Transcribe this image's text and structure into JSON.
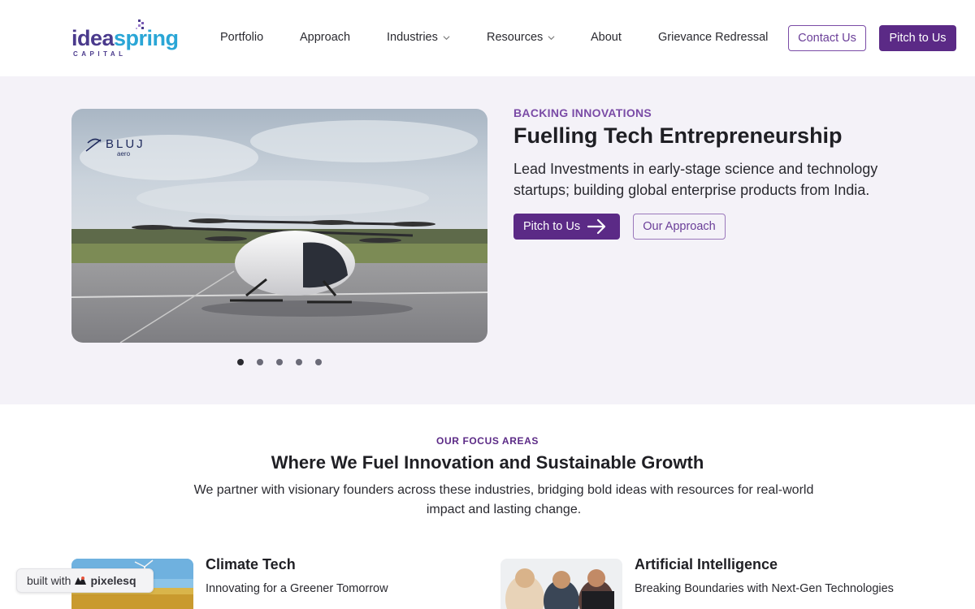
{
  "header": {
    "logo": {
      "part1": "idea",
      "part2": "spring",
      "sub": "CAPITAL"
    },
    "nav": [
      {
        "label": "Portfolio"
      },
      {
        "label": "Approach"
      },
      {
        "label": "Industries"
      },
      {
        "label": "Resources"
      },
      {
        "label": "About"
      },
      {
        "label": "Grievance Redressal"
      }
    ],
    "contact_label": "Contact Us",
    "pitch_label": "Pitch to Us"
  },
  "hero": {
    "image_logo": "BLUJ aero",
    "image_logo_main": "BLUJ",
    "image_logo_sub": "aero",
    "eyebrow": "BACKING INNOVATIONS",
    "title": "Fuelling Tech Entrepreneurship",
    "description": "Lead Investments in early-stage science and technology startups; building global enterprise products from India.",
    "primary_cta": "Pitch to Us",
    "secondary_cta": "Our Approach",
    "slides_count": 5,
    "active_slide": 1
  },
  "focus": {
    "eyebrow": "OUR FOCUS AREAS",
    "title": "Where We Fuel Innovation and Sustainable Growth",
    "description": "We partner with visionary founders across these industries, bridging bold ideas with resources for real-world impact and lasting change.",
    "cards": [
      {
        "title": "Climate Tech",
        "subtitle": "Innovating for a Greener Tomorrow"
      },
      {
        "title": "Artificial Intelligence",
        "subtitle": "Breaking Boundaries with Next-Gen Technologies"
      }
    ]
  },
  "badge": {
    "prefix": "built with",
    "brand": "pixelesq"
  },
  "colors": {
    "primary": "#5b2a86",
    "accent": "#7a4ba6",
    "logo_blue": "#2aa6d6",
    "hero_bg": "#f4f2f8"
  }
}
